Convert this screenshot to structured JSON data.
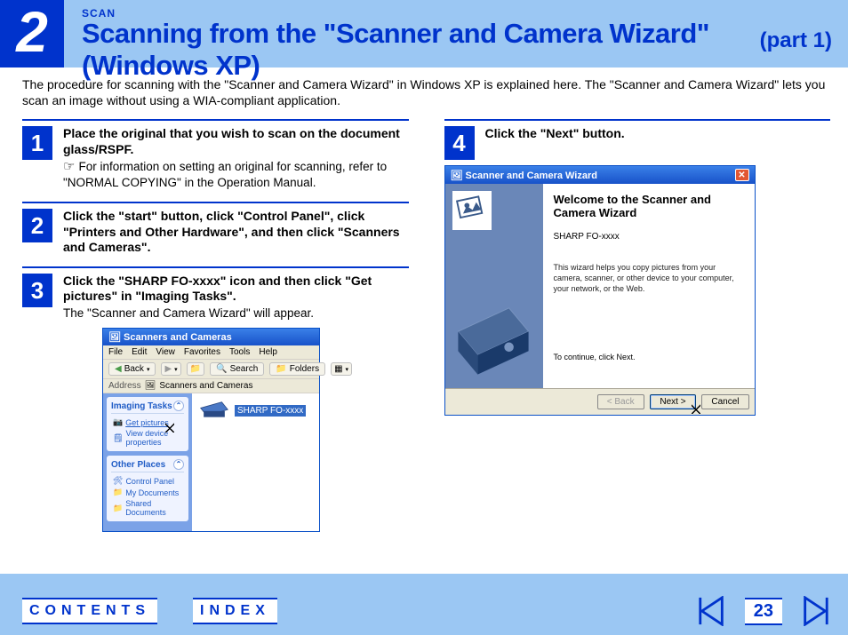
{
  "header": {
    "chapter_num": "2",
    "section": "SCAN",
    "title": "Scanning from the \"Scanner and Camera Wizard\" (Windows XP)",
    "part": "(part 1)"
  },
  "intro": "The procedure for scanning with the \"Scanner and Camera Wizard\" in Windows XP is explained here. The \"Scanner and Camera Wizard\" lets you scan an image without using a WIA-compliant application.",
  "steps": {
    "s1": {
      "num": "1",
      "title": "Place the original that you wish to scan on the document glass/RSPF.",
      "sub": "For information on setting an original for scanning, refer to \"NORMAL COPYING\" in the Operation Manual."
    },
    "s2": {
      "num": "2",
      "title": "Click the \"start\" button, click \"Control Panel\", click \"Printers and Other Hardware\", and then click \"Scanners and Cameras\"."
    },
    "s3": {
      "num": "3",
      "title": "Click the \"SHARP FO-xxxx\" icon and then click \"Get pictures\" in \"Imaging Tasks\".",
      "sub": "The \"Scanner and Camera Wizard\" will appear."
    },
    "s4": {
      "num": "4",
      "title": "Click the \"Next\" button."
    }
  },
  "xp_explorer": {
    "title": "Scanners and Cameras",
    "menu": [
      "File",
      "Edit",
      "View",
      "Favorites",
      "Tools",
      "Help"
    ],
    "toolbar": {
      "back": "Back",
      "search": "Search",
      "folders": "Folders"
    },
    "addr_label": "Address",
    "addr_value": "Scanners and Cameras",
    "panel1": {
      "title": "Imaging Tasks",
      "items": [
        "Get pictures",
        "View device properties"
      ]
    },
    "panel2": {
      "title": "Other Places",
      "items": [
        "Control Panel",
        "My Documents",
        "Shared Documents"
      ]
    },
    "device": "SHARP FO-xxxx"
  },
  "wizard": {
    "title": "Scanner and Camera Wizard",
    "heading": "Welcome to the Scanner and Camera Wizard",
    "device": "SHARP FO-xxxx",
    "desc": "This wizard helps you copy pictures from your camera, scanner, or other device to your computer, your network, or the Web.",
    "continue": "To continue, click Next.",
    "buttons": {
      "back": "< Back",
      "next": "Next >",
      "cancel": "Cancel"
    }
  },
  "footer": {
    "contents": "CONTENTS",
    "index": "INDEX",
    "page": "23"
  }
}
